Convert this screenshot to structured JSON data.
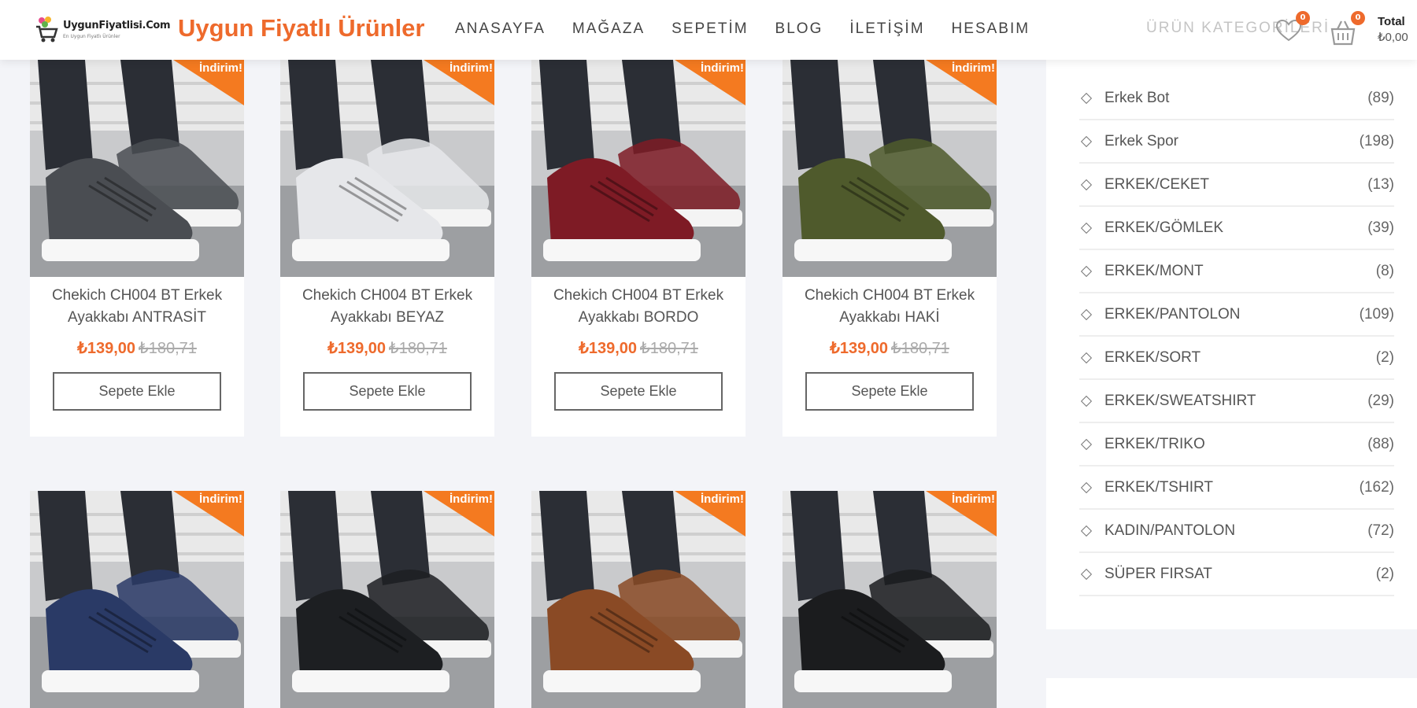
{
  "header": {
    "logo_line1": "UygunFiyatlisi.Com",
    "logo_line2": "En Uygun Fiyatlı Ürünler",
    "site_title": "Uygun Fiyatlı Ürünler",
    "nav": [
      "ANASAYFA",
      "MAĞAZA",
      "SEPETİM",
      "BLOG",
      "İLETİŞİM",
      "HESABIM"
    ],
    "category_search_placeholder": "ÜRÜN KATEGORİLERİ",
    "wishlist_count": "0",
    "cart_count": "0",
    "total_label": "Total",
    "total_value": "₺0,00",
    "accent_color": "#ee6a2c"
  },
  "products": [
    {
      "name": "Chekich CH004 BT Erkek Ayakkabı ANTRASİT",
      "price": "₺139,00",
      "old_price": "₺180,71",
      "badge": "İndirim!",
      "button": "Sepete Ekle",
      "shoe_color": "#4a4d52"
    },
    {
      "name": "Chekich CH004 BT Erkek Ayakkabı BEYAZ",
      "price": "₺139,00",
      "old_price": "₺180,71",
      "badge": "İndirim!",
      "button": "Sepete Ekle",
      "shoe_color": "#e6e7ea"
    },
    {
      "name": "Chekich CH004 BT Erkek Ayakkabı BORDO",
      "price": "₺139,00",
      "old_price": "₺180,71",
      "badge": "İndirim!",
      "button": "Sepete Ekle",
      "shoe_color": "#7e1b25"
    },
    {
      "name": "Chekich CH004 BT Erkek Ayakkabı HAKİ",
      "price": "₺139,00",
      "old_price": "₺180,71",
      "badge": "İndirim!",
      "button": "Sepete Ekle",
      "shoe_color": "#4f5a2c"
    },
    {
      "name": "",
      "price": "",
      "old_price": "",
      "badge": "İndirim!",
      "button": "",
      "shoe_color": "#2a3a66"
    },
    {
      "name": "",
      "price": "",
      "old_price": "",
      "badge": "İndirim!",
      "button": "",
      "shoe_color": "#1d1f22"
    },
    {
      "name": "",
      "price": "",
      "old_price": "",
      "badge": "İndirim!",
      "button": "",
      "shoe_color": "#8a4a25"
    },
    {
      "name": "",
      "price": "",
      "old_price": "",
      "badge": "İndirim!",
      "button": "",
      "shoe_color": "#1b1c1e"
    }
  ],
  "categories": [
    {
      "name": "Erkek Bot",
      "count": "(89)"
    },
    {
      "name": "Erkek Spor",
      "count": "(198)"
    },
    {
      "name": "ERKEK/CEKET",
      "count": "(13)"
    },
    {
      "name": "ERKEK/GÖMLEK",
      "count": "(39)"
    },
    {
      "name": "ERKEK/MONT",
      "count": "(8)"
    },
    {
      "name": "ERKEK/PANTOLON",
      "count": "(109)"
    },
    {
      "name": "ERKEK/SORT",
      "count": "(2)"
    },
    {
      "name": "ERKEK/SWEATSHIRT",
      "count": "(29)"
    },
    {
      "name": "ERKEK/TRIKO",
      "count": "(88)"
    },
    {
      "name": "ERKEK/TSHIRT",
      "count": "(162)"
    },
    {
      "name": "KADIN/PANTOLON",
      "count": "(72)"
    },
    {
      "name": "SÜPER FIRSAT",
      "count": "(2)"
    }
  ]
}
